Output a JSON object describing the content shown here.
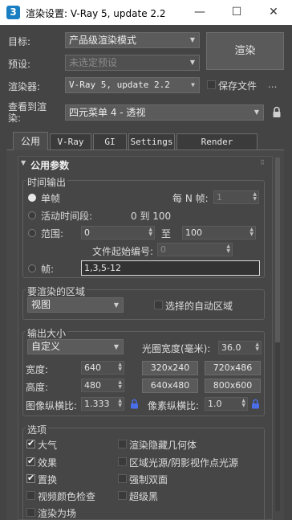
{
  "window": {
    "title": "渲染设置: V-Ray 5, update 2.2",
    "minimize_glyph": "—",
    "maximize_glyph": "☐",
    "close_glyph": "✕"
  },
  "header": {
    "target_label": "目标:",
    "target_value": "产品级渲染模式",
    "preset_label": "预设:",
    "preset_value": "未选定预设",
    "renderer_label": "渲染器:",
    "renderer_value": "V-Ray 5, update 2.2",
    "save_file_label": "保存文件",
    "more_label": "...",
    "render_button": "渲染",
    "view_label_line1": "查看到渲",
    "view_label_line2": "染:",
    "view_value": "四元菜单 4 - 透视"
  },
  "tabs": [
    "公用",
    "V-Ray",
    "GI",
    "Settings",
    "Render Elements"
  ],
  "common": {
    "rollout_title": "公用参数",
    "time_output": {
      "title": "时间输出",
      "single_label": "单帧",
      "every_n_label": "每 N 帧:",
      "every_n_value": "1",
      "active_segment_label": "活动时间段:",
      "active_segment_value": "0 到 100",
      "range_label": "范围:",
      "range_from": "0",
      "range_to_label": "至",
      "range_to": "100",
      "file_start_label": "文件起始编号:",
      "file_start_value": "0",
      "frames_label": "帧:",
      "frames_value": "1,3,5-12"
    },
    "area": {
      "title": "要渲染的区域",
      "area_value": "视图",
      "auto_region_label": "选择的自动区域"
    },
    "output_size": {
      "title": "输出大小",
      "preset_value": "自定义",
      "aperture_label": "光圈宽度(毫米):",
      "aperture_value": "36.0",
      "width_label": "宽度:",
      "width_value": "640",
      "height_label": "高度:",
      "height_value": "480",
      "preset_buttons": [
        "320x240",
        "720x486",
        "640x480",
        "800x600"
      ],
      "image_aspect_label": "图像纵横比:",
      "image_aspect_value": "1.333",
      "pixel_aspect_label": "像素纵横比:",
      "pixel_aspect_value": "1.0"
    },
    "options": {
      "title": "选项",
      "items": [
        {
          "label": "大气",
          "checked": true
        },
        {
          "label": "渲染隐藏几何体",
          "checked": false
        },
        {
          "label": "效果",
          "checked": true
        },
        {
          "label": "区域光源/阴影视作点光源",
          "checked": false
        },
        {
          "label": "置换",
          "checked": true
        },
        {
          "label": "强制双面",
          "checked": false
        },
        {
          "label": "视频颜色检查",
          "checked": false
        },
        {
          "label": "超级黑",
          "checked": false
        },
        {
          "label": "渲染为场",
          "checked": false
        }
      ]
    }
  },
  "colors": {
    "background": "#444444",
    "accent_blue": "#1a7fc2",
    "lock_icon": "#4a6de8"
  }
}
